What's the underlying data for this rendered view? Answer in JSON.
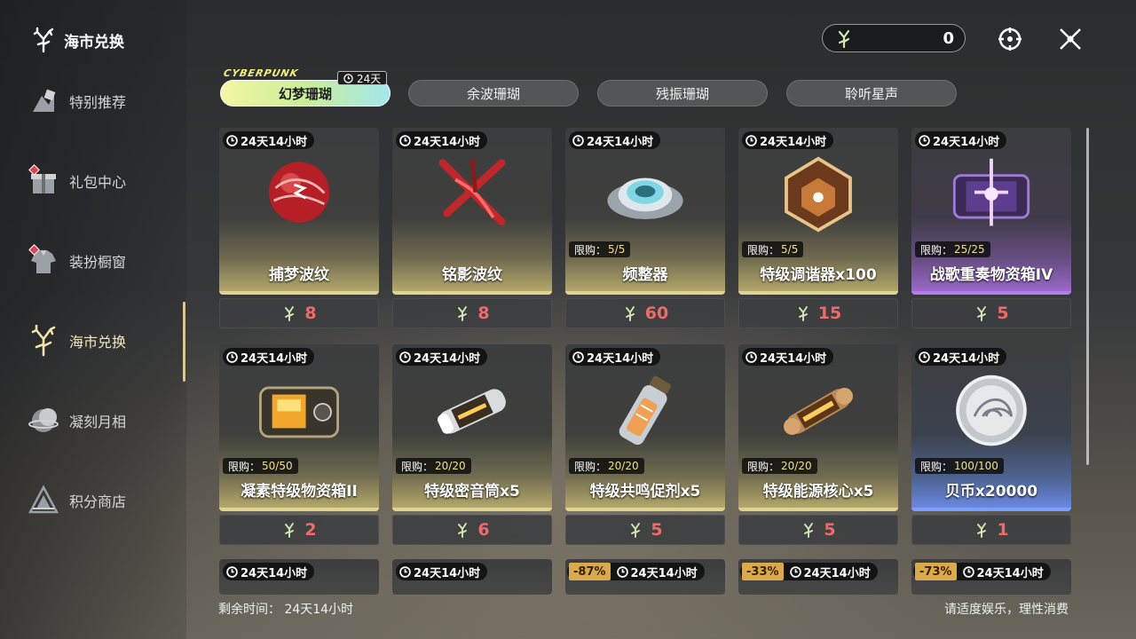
{
  "sidebar": {
    "title": "海市兑换",
    "items": [
      {
        "label": "特别推荐",
        "icon": "recommend-icon",
        "dot": false
      },
      {
        "label": "礼包中心",
        "icon": "gift-icon",
        "dot": true
      },
      {
        "label": "装扮橱窗",
        "icon": "outfit-icon",
        "dot": true
      },
      {
        "label": "海市兑换",
        "icon": "coral-icon",
        "dot": false,
        "active": true
      },
      {
        "label": "凝刻月相",
        "icon": "moon-icon",
        "dot": false
      },
      {
        "label": "积分商店",
        "icon": "points-icon",
        "dot": false
      }
    ]
  },
  "header": {
    "currency_amount": "0",
    "currency_icon": "coral-icon",
    "help_icon": "help-icon",
    "close_icon": "close-icon"
  },
  "tabs": [
    {
      "label": "幻梦珊瑚",
      "active": true,
      "badge": "24天",
      "logo": "CYBERPUNK"
    },
    {
      "label": "余波珊瑚"
    },
    {
      "label": "残振珊瑚"
    },
    {
      "label": "聆听星声"
    }
  ],
  "items": [
    {
      "timer": "24天14小时",
      "name": "捕梦波纹",
      "price": "8",
      "limit": "",
      "art": "red-orb"
    },
    {
      "timer": "24天14小时",
      "name": "铭影波纹",
      "price": "8",
      "limit": "",
      "art": "red-ribbon"
    },
    {
      "timer": "24天14小时",
      "name": "频整器",
      "price": "60",
      "limit": "5/5",
      "art": "tuner"
    },
    {
      "timer": "24天14小时",
      "name": "特级调谐器x100",
      "price": "15",
      "limit": "5/5",
      "art": "dice"
    },
    {
      "timer": "24天14小时",
      "name": "战歌重奏物资箱IV",
      "price": "5",
      "limit": "25/25",
      "art": "purple-box",
      "rarity": "purple"
    },
    {
      "timer": "24天14小时",
      "name": "凝素特级物资箱II",
      "price": "2",
      "limit": "50/50",
      "art": "gold-box"
    },
    {
      "timer": "24天14小时",
      "name": "特级密音筒x5",
      "price": "6",
      "limit": "20/20",
      "art": "tube"
    },
    {
      "timer": "24天14小时",
      "name": "特级共鸣促剂x5",
      "price": "5",
      "limit": "20/20",
      "art": "vial"
    },
    {
      "timer": "24天14小时",
      "name": "特级能源核心x5",
      "price": "5",
      "limit": "20/20",
      "art": "core"
    },
    {
      "timer": "24天14小时",
      "name": "贝币x20000",
      "price": "1",
      "limit": "100/100",
      "art": "coin",
      "rarity": "blue"
    }
  ],
  "row3": [
    {
      "timer": "24天14小时",
      "discount": ""
    },
    {
      "timer": "24天14小时",
      "discount": ""
    },
    {
      "timer": "24天14小时",
      "discount": "-87%"
    },
    {
      "timer": "24天14小时",
      "discount": "-33%"
    },
    {
      "timer": "24天14小时",
      "discount": "-73%"
    }
  ],
  "limit_label": "限购：",
  "footer": {
    "remaining": "剩余时间：  24天14小时",
    "notice": "请适度娱乐，理性消费"
  }
}
